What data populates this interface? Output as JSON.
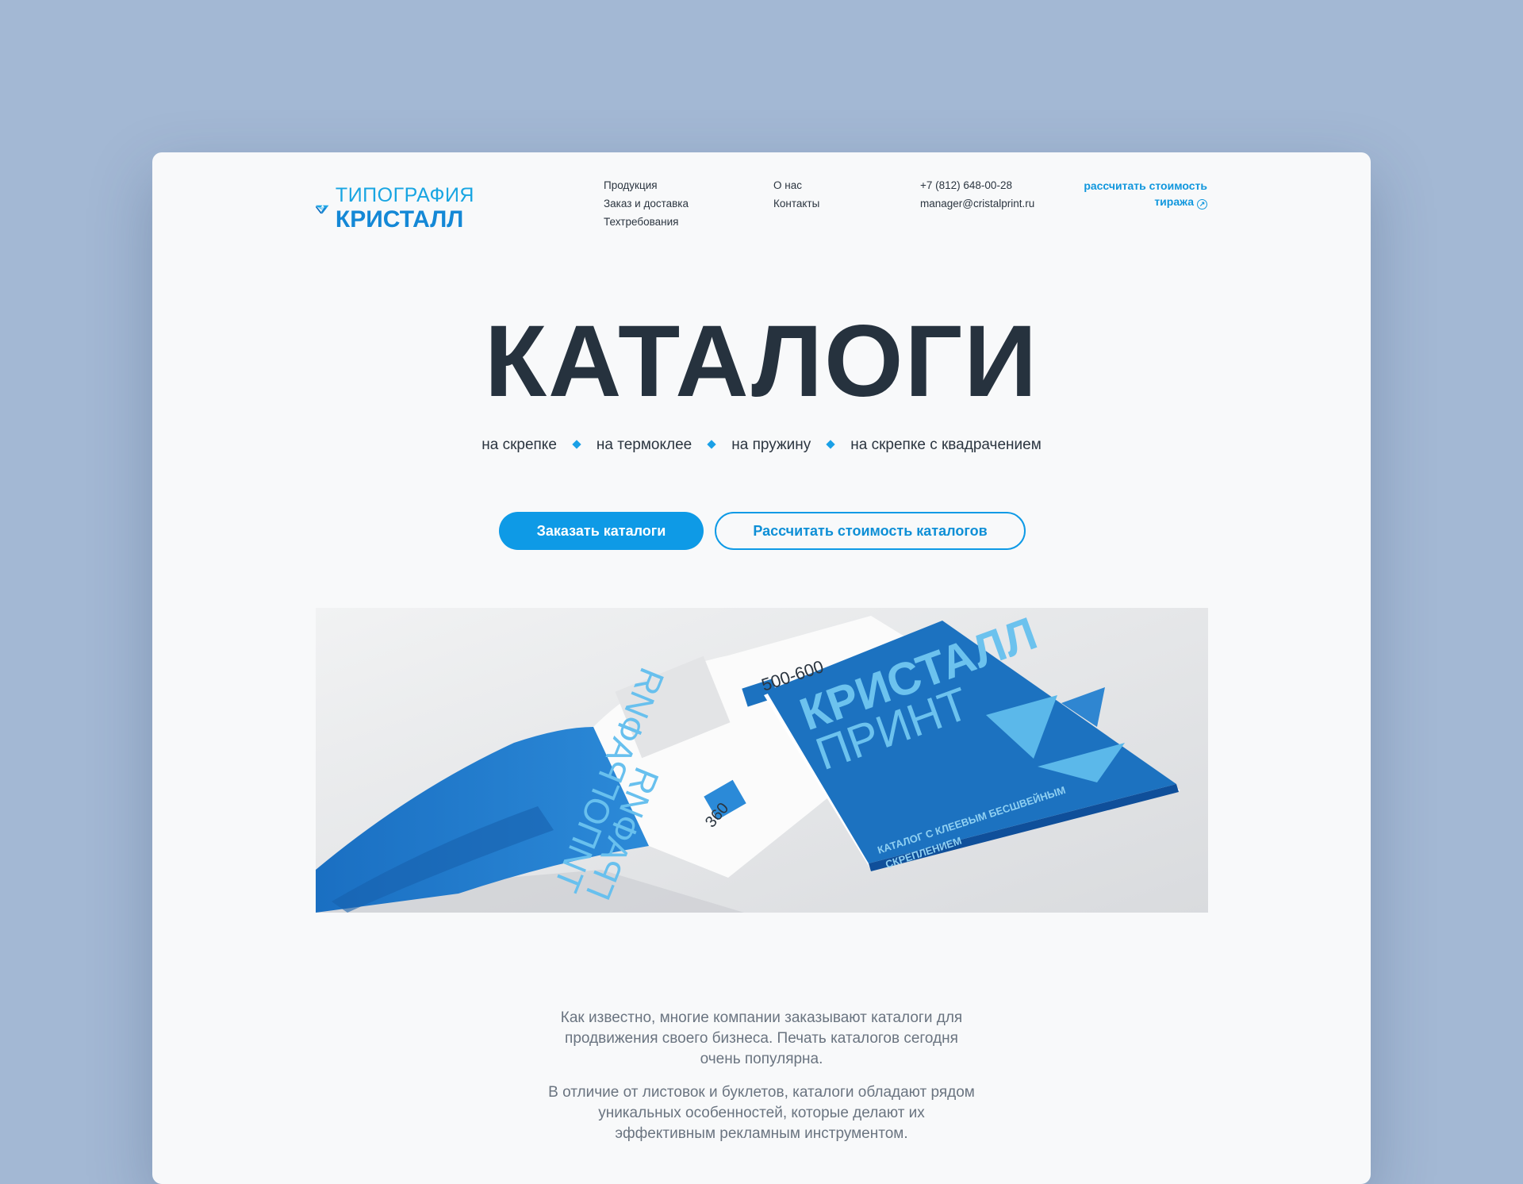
{
  "logo": {
    "line1": "ТИПОГРАФИЯ",
    "line2": "КРИСТАЛЛ"
  },
  "nav": {
    "col1": [
      "Продукция",
      "Заказ и доставка",
      "Техтребования"
    ],
    "col2": [
      "О нас",
      "Контакты"
    ]
  },
  "contacts": {
    "phone": "+7 (812) 648-00-28",
    "email": "manager@cristalprint.ru"
  },
  "header_cta": {
    "line1": "рассчитать стоимость",
    "line2": "тиража"
  },
  "hero": {
    "title": "КАТАЛОГИ",
    "tags": [
      "на скрепке",
      "на термоклее",
      "на пружину",
      "на скрепке с квадрачением"
    ],
    "primary_button": "Заказать каталоги",
    "secondary_button": "Рассчитать стоимость каталогов"
  },
  "image_texts": {
    "cover_line1": "КРИСТАЛЛ",
    "cover_line2": "ПРИНТ",
    "cover_sub1": "КАТАЛОГ С КЛЕЕВЫМ БЕСШВЕЙНЫМ",
    "cover_sub2": "СКРЕПЛЕНИЕМ",
    "number_1": "500-600",
    "number_2": "360",
    "spread_line1": "ТИПОГРАФИЯ",
    "spread_line2": "ГРАФИЯ"
  },
  "about": [
    "Как известно, многие компании заказывают каталоги для продвижения своего бизнеса. Печать каталогов сегодня очень популярна.",
    "В отличие от листовок и буклетов, каталоги обладают рядом уникальных особенностей, которые делают их эффективным рекламным инструментом."
  ],
  "colors": {
    "background": "#a3b8d4",
    "accent": "#0e9ae6",
    "title": "#26323e",
    "catalog_blue": "#1c72c0"
  }
}
